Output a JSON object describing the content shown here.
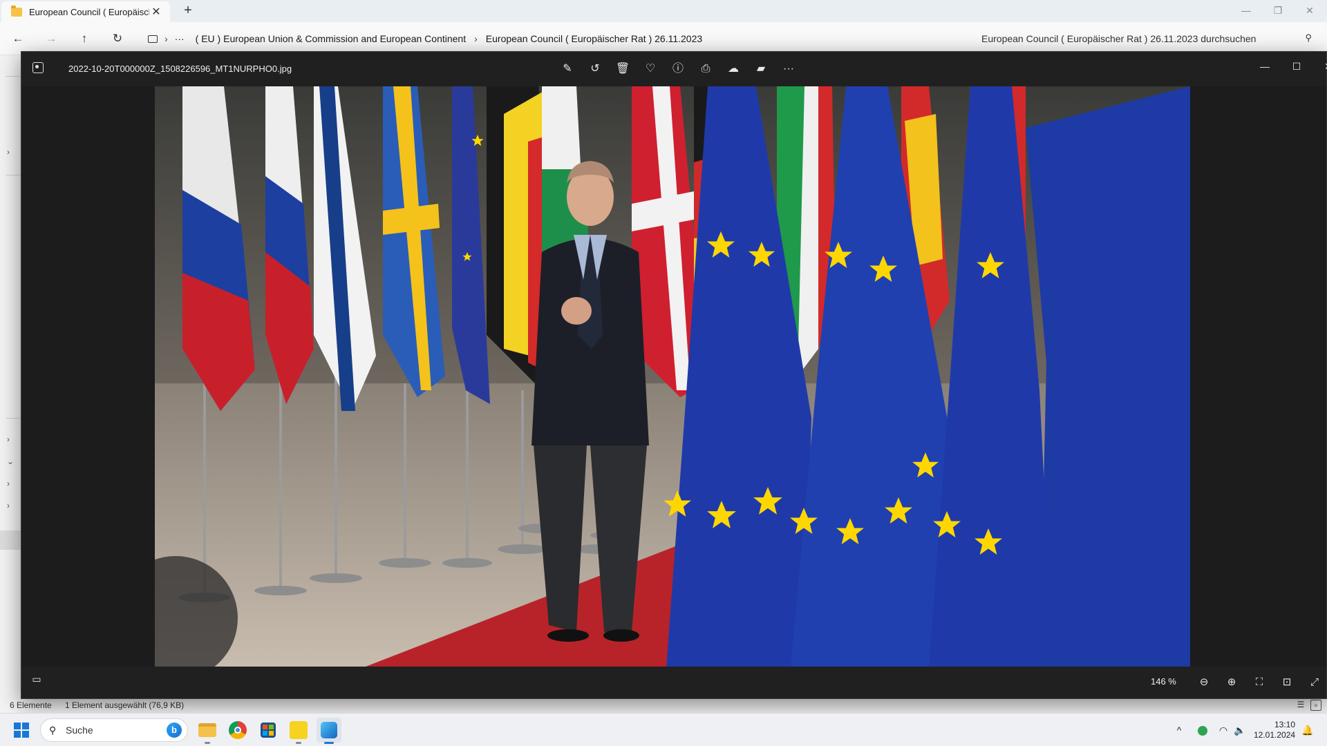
{
  "explorer": {
    "tab_title": "European Council ( Europäisch",
    "tab_close": "✕",
    "new_tab": "+",
    "window_controls": {
      "minimize": "—",
      "restore": "❐",
      "close": "✕"
    },
    "nav": {
      "back": "←",
      "forward": "→",
      "up": "↑",
      "refresh": "↻"
    },
    "breadcrumb": {
      "overflow": "···",
      "items": [
        "( EU ) European Union & Commission and European Continent",
        "European Council ( Europäischer Rat ) 26.11.2023"
      ]
    },
    "search_placeholder": "European Council ( Europäischer Rat ) 26.11.2023 durchsuchen",
    "status": {
      "count": "6 Elemente",
      "selection": "1 Element ausgewählt (76,9 KB)"
    }
  },
  "photos": {
    "filename": "2022-10-20T000000Z_1508226596_MT1NURPHO0.jpg",
    "toolbar": [
      {
        "name": "edit-image-icon",
        "glyph": "✎"
      },
      {
        "name": "rotate-icon",
        "glyph": "↺"
      },
      {
        "name": "delete-icon",
        "glyph": "🗑"
      },
      {
        "name": "favorite-icon",
        "glyph": "♡"
      },
      {
        "name": "info-icon",
        "glyph": "ⓘ"
      },
      {
        "name": "print-icon",
        "glyph": "⎙"
      },
      {
        "name": "onedrive-icon",
        "glyph": "☁"
      },
      {
        "name": "clipchamp-icon",
        "glyph": "▰"
      },
      {
        "name": "more-options-icon",
        "glyph": "···"
      }
    ],
    "window_controls": {
      "minimize": "—",
      "maximize": "☐",
      "close": "✕"
    },
    "zoom_level": "146 %",
    "bottom_buttons": {
      "filmstrip": "▭",
      "zoom_out": "⊖",
      "zoom_in": "⊕",
      "fit": "⛶",
      "actual_size": "⊡",
      "fullscreen": "⤢"
    }
  },
  "taskbar": {
    "search_placeholder": "Suche",
    "bing_label": "b",
    "apps": [
      "file-explorer",
      "chrome",
      "microsoft-store",
      "media-player",
      "photos"
    ],
    "tray": {
      "chevron": "^",
      "wifi": "◠",
      "volume": "🔈",
      "bell": "🔔"
    },
    "time": "13:10",
    "date": "12.01.2024"
  },
  "colors": {
    "accent": "#1a78d4",
    "photos_bg": "#202020",
    "eu_blue": "#1f3fa8",
    "eu_star": "#ffd700",
    "carpet_red": "#b8232a"
  }
}
